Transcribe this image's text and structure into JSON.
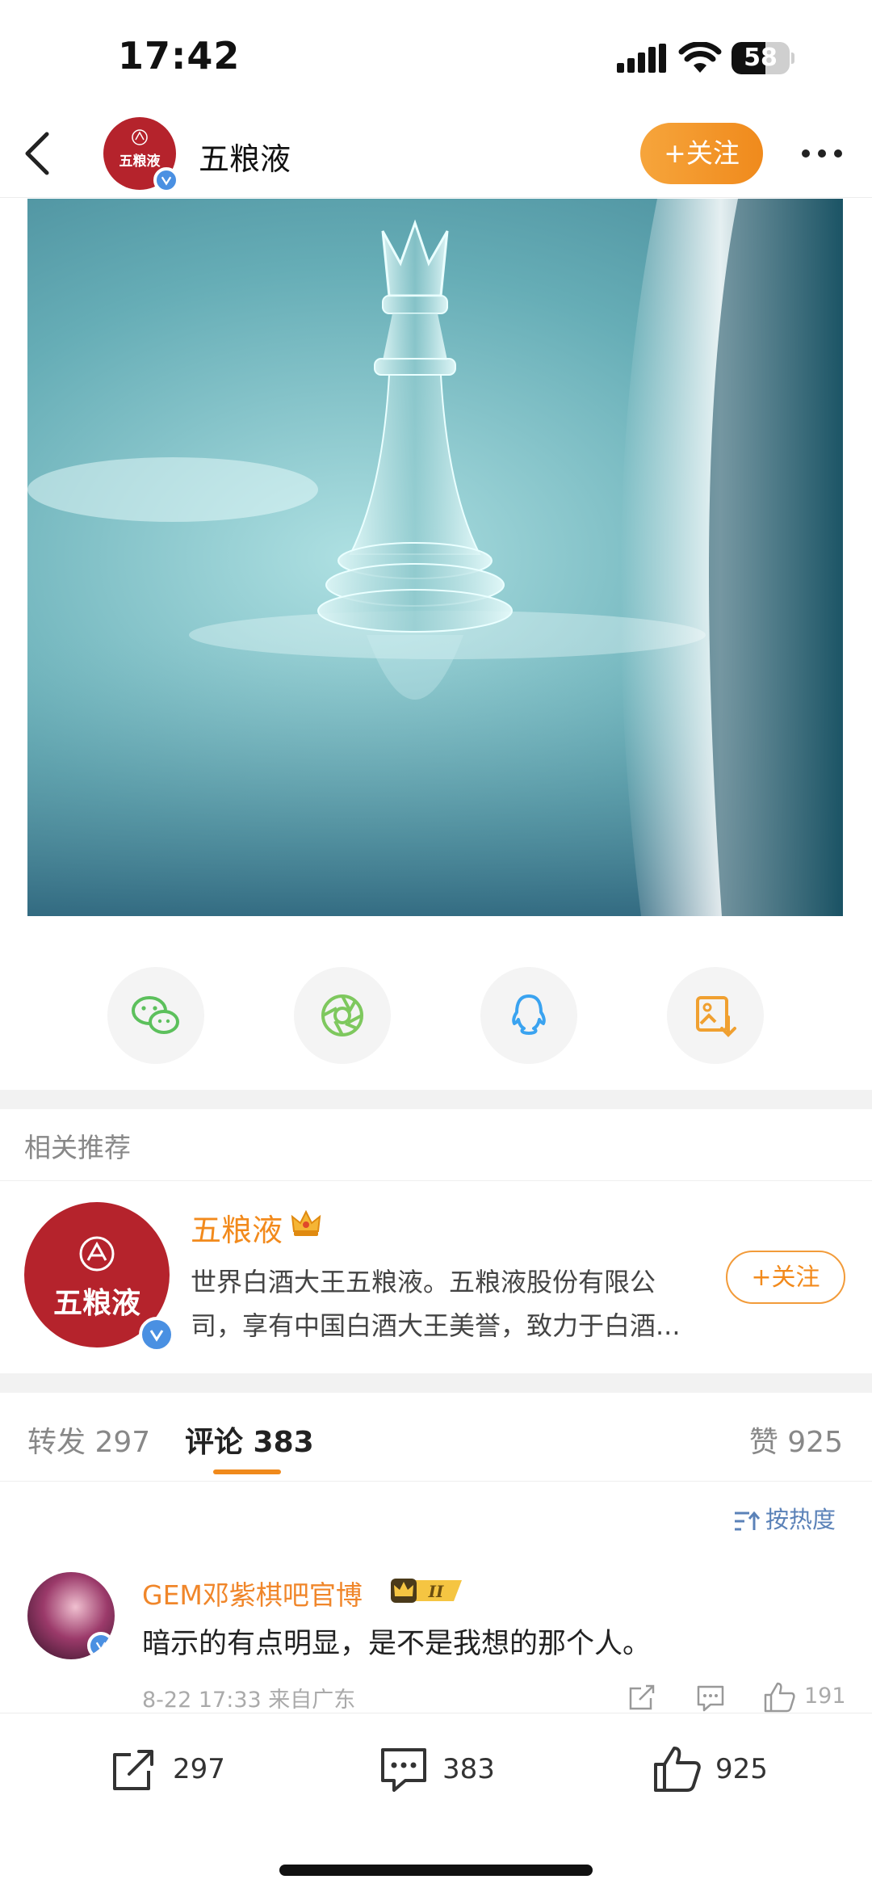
{
  "status_bar": {
    "time": "17:42",
    "battery": "58",
    "battery_level": 0.58
  },
  "header": {
    "account_name": "五粮液",
    "follow_label": "+关注",
    "avatar_logo_text": "五粮液"
  },
  "share_targets": [
    "wechat-icon",
    "moments-icon",
    "qq-icon",
    "save-image-icon"
  ],
  "related": {
    "section_title": "相关推荐",
    "account_name": "五粮液",
    "description_line1": "世界白酒大王五粮液。五粮液股份有限公",
    "description_line2": "司，享有中国白酒大王美誉，致力于白酒...",
    "follow_label": "+关注"
  },
  "tabs": {
    "repost_label": "转发 297",
    "comment_label": "评论 383",
    "like_label": "赞 925"
  },
  "sort": {
    "label": "按热度"
  },
  "comment": {
    "username": "GEM邓紫棋吧官博",
    "vip_level": "II",
    "text": "暗示的有点明显，是不是我想的那个人。",
    "meta": "8-22 17:33  来自广东",
    "like_count": "191"
  },
  "bottom_bar": {
    "repost_count": "297",
    "comment_count": "383",
    "like_count": "925"
  },
  "colors": {
    "accent_orange": "#f08a1c",
    "brand_red": "#b5232c",
    "link_blue": "#5b82b8"
  }
}
